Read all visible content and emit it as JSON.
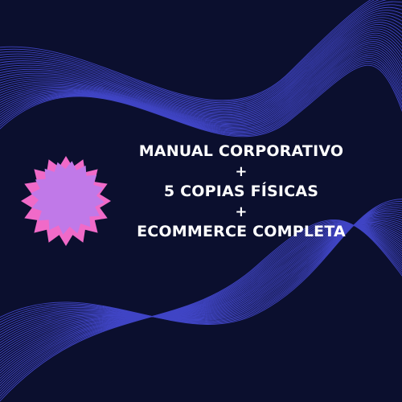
{
  "offer": {
    "line1": "MANUAL CORPORATIVO",
    "plus1": "+",
    "line2": "5 COPIAS FÍSICAS",
    "plus2": "+",
    "line3": "ECOMMERCE COMPLETA"
  },
  "colors": {
    "background": "#0b0f2e",
    "wave_line": "#4a4fe0",
    "badge_outer": "#f06ac8",
    "badge_inner": "#c079e8",
    "text": "#ffffff"
  }
}
